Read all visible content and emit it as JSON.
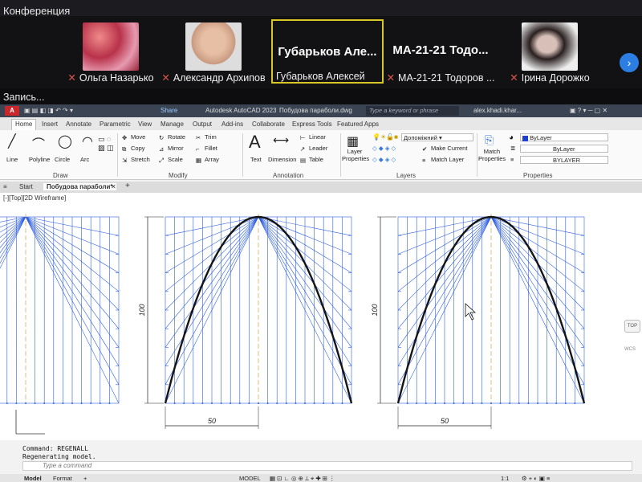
{
  "conference": {
    "title": "Конференция",
    "recording_label": "Запись..."
  },
  "participants": [
    {
      "name": "Ольга Назарько",
      "muted": true,
      "avatar": "roses-photo"
    },
    {
      "name": "Александр Архипов",
      "muted": true,
      "avatar": "man-photo"
    },
    {
      "name": "Губарьков Алексей",
      "display": "Губарьков Але...",
      "muted": false,
      "active": true
    },
    {
      "name": "МА-21-21 Тодоров ...",
      "display": "МА-21-21 Тодо...",
      "muted": true
    },
    {
      "name": "Ірина Дорожко",
      "muted": true,
      "avatar": "woman-photo"
    }
  ],
  "acad": {
    "app_title": "Autodesk AutoCAD 2023",
    "file_name": "Побудова параболи.dwg",
    "search_placeholder": "Type a keyword or phrase",
    "user": "alex.khadi.khar...",
    "share": "Share",
    "tabs": [
      "Home",
      "Insert",
      "Annotate",
      "Parametric",
      "View",
      "Manage",
      "Output",
      "Add-ins",
      "Collaborate",
      "Express Tools",
      "Featured Apps"
    ],
    "draw": {
      "line": "Line",
      "polyline": "Polyline",
      "circle": "Circle",
      "arc": "Arc",
      "label": "Draw"
    },
    "modify": {
      "move": "Move",
      "rotate": "Rotate",
      "trim": "Trim",
      "copy": "Copy",
      "mirror": "Mirror",
      "fillet": "Fillet",
      "stretch": "Stretch",
      "scale": "Scale",
      "array": "Array",
      "label": "Modify"
    },
    "annotation": {
      "text": "Text",
      "dimension": "Dimension",
      "linear": "Linear",
      "leader": "Leader",
      "table": "Table",
      "label": "Annotation"
    },
    "layers": {
      "props": "Layer Properties",
      "current_layer": "Допоміжний",
      "make_current": "Make Current",
      "match_layer": "Match Layer",
      "label": "Layers"
    },
    "properties": {
      "match": "Match Properties",
      "color": "ByLayer",
      "linetype": "ByLayer",
      "lineweight": "BYLAYER",
      "label": "Properties"
    },
    "doc_tabs": {
      "start": "Start",
      "doc": "Побудова параболи*"
    },
    "viewport_label": "[-][Top][2D Wireframe]",
    "viewcube": "TOP",
    "wcs": "WCS",
    "dims": {
      "height": "100",
      "half_width": "50"
    },
    "command_history": [
      "Command: REGENALL",
      "Regenerating model."
    ],
    "command_placeholder": "Type a command",
    "status": {
      "model_tab": "Model",
      "layout_tab": "Format",
      "model_btn": "MODEL",
      "scale": "1:1"
    }
  },
  "colors": {
    "construction": "#2f5fe0",
    "curve": "#151515",
    "accent": "#d7c623",
    "mic_off": "#e2574c"
  }
}
